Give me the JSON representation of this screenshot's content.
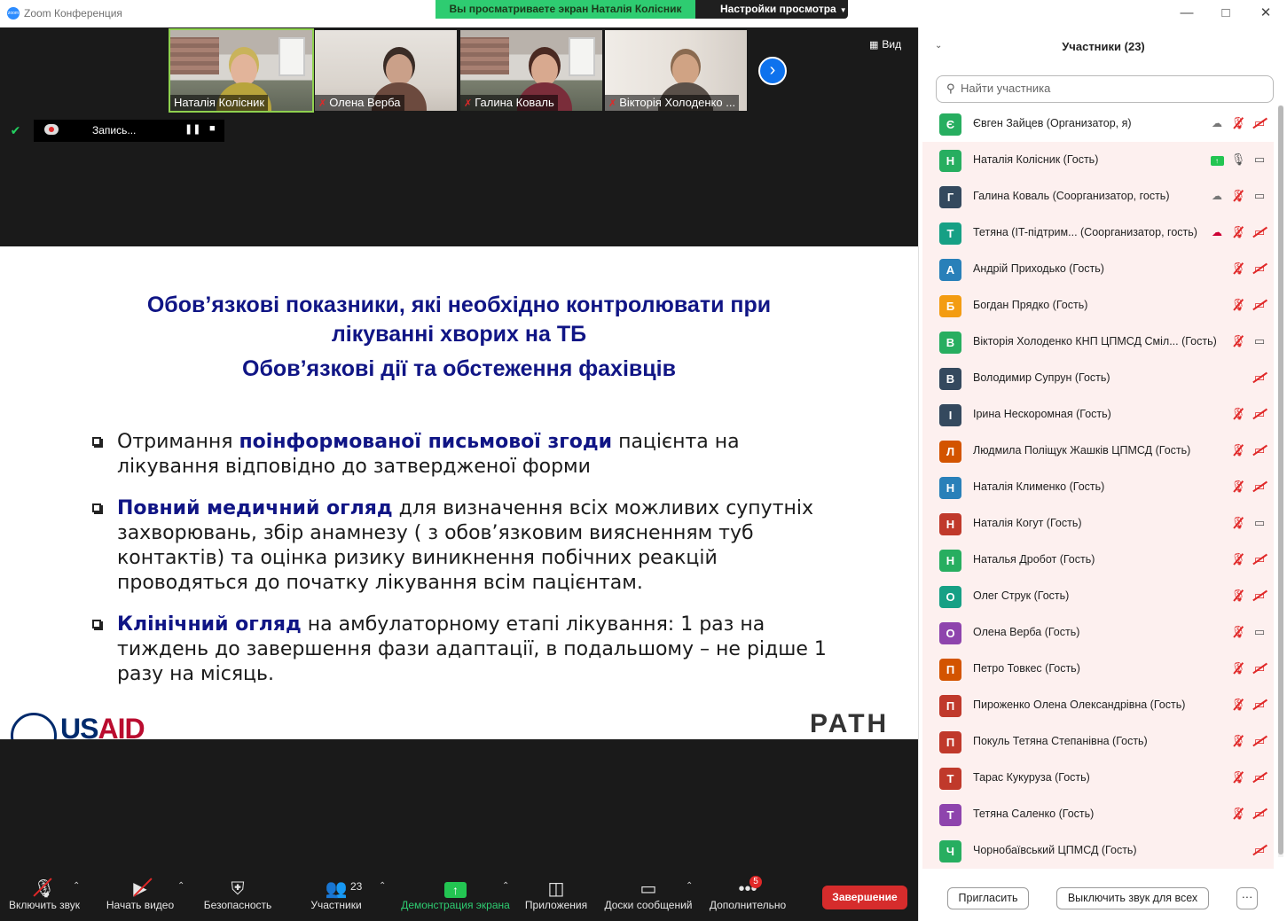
{
  "window": {
    "app_title": "Zoom Конференция",
    "app_logo_text": "zoom",
    "share_banner": "Вы просматриваете экран Наталія Колісник",
    "view_options": "Настройки просмотра"
  },
  "video": {
    "thumbnails": [
      {
        "name": "Наталія Колісник",
        "muted": false,
        "active": true
      },
      {
        "name": "Олена Верба",
        "muted": true,
        "active": false
      },
      {
        "name": "Галина Коваль",
        "muted": true,
        "active": false
      },
      {
        "name": "Вікторія Холоденко ...",
        "muted": true,
        "active": false
      }
    ],
    "view_label": "Вид",
    "recording_label": "Запись..."
  },
  "slide": {
    "title_line1": "Обов’язкові показники, які необхідно контролювати при",
    "title_line2": "лікуванні хворих на ТБ",
    "title_line3": "Обов’язкові дії та обстеження фахівців",
    "bullets": [
      {
        "pre": "Отримання ",
        "hl": "поінформованої письмової згоди",
        "post": " пацієнта на лікування відповідно до затвердженої форми"
      },
      {
        "pre": "",
        "hl": "Повний медичний огляд",
        "post": " для визначення всіх можливих супутніх захворювань, збір анамнезу ( з обов’язковим виясненням туб контактів) та оцінка ризику виникнення побічних реакцій проводяться до початку лікування всім пацієнтам."
      },
      {
        "pre": "",
        "hl": "Клінічний огляд",
        "post": " на амбулаторному етапі лікування: 1 раз на тиждень до завершення фази адаптації, в подальшому – не рідше 1 разу на місяць."
      }
    ],
    "logo_left": "USAID",
    "logo_right": "PATH"
  },
  "toolbar": {
    "audio": "Включить звук",
    "video": "Начать видео",
    "security": "Безопасность",
    "participants": "Участники",
    "participants_count": "23",
    "share": "Демонстрация экрана",
    "apps": "Приложения",
    "whiteboards": "Доски сообщений",
    "more": "Дополнительно",
    "more_badge": "5",
    "end": "Завершение"
  },
  "panel": {
    "title": "Участники (23)",
    "search_placeholder": "Найти участника",
    "participants": [
      {
        "initial": "Є",
        "name": "Євген Зайцев (Организатор, я)",
        "color": "#27ae60",
        "icons": [
          "cloud",
          "mic-off",
          "cam-off"
        ]
      },
      {
        "initial": "Н",
        "name": "Наталія Колісник (Гость)",
        "color": "#27ae60",
        "icons": [
          "share",
          "mic-on",
          "cam-on"
        ]
      },
      {
        "initial": "Г",
        "name": "Галина Коваль (Соорганизатор, гость)",
        "color": "#34495e",
        "icons": [
          "cloud",
          "mic-off",
          "cam-on"
        ]
      },
      {
        "initial": "Т",
        "name": "Тетяна (IT-підтрим...  (Соорганизатор, гость)",
        "color": "#16a085",
        "icons": [
          "cloud-red",
          "mic-off",
          "cam-off"
        ]
      },
      {
        "initial": "А",
        "name": "Андрій Приходько (Гость)",
        "color": "#2980b9",
        "icons": [
          "mic-off",
          "cam-off"
        ]
      },
      {
        "initial": "Б",
        "name": "Богдан Прядко (Гость)",
        "color": "#f39c12",
        "icons": [
          "mic-off",
          "cam-off"
        ]
      },
      {
        "initial": "В",
        "name": "Вікторія Холоденко КНП ЦПМСД Сміл...  (Гость)",
        "color": "#27ae60",
        "icons": [
          "mic-off",
          "cam-on"
        ]
      },
      {
        "initial": "В",
        "name": "Володимир Супрун (Гость)",
        "color": "#34495e",
        "icons": [
          "cam-off"
        ]
      },
      {
        "initial": "І",
        "name": "Ірина Нескоромная (Гость)",
        "color": "#34495e",
        "icons": [
          "mic-off",
          "cam-off"
        ]
      },
      {
        "initial": "Л",
        "name": "Людмила Поліщук Жашків ЦПМСД (Гость)",
        "color": "#d35400",
        "icons": [
          "mic-off",
          "cam-off"
        ]
      },
      {
        "initial": "Н",
        "name": "Наталія Клименко (Гость)",
        "color": "#2980b9",
        "icons": [
          "mic-off",
          "cam-off"
        ]
      },
      {
        "initial": "Н",
        "name": "Наталія Когут (Гость)",
        "color": "#c0392b",
        "icons": [
          "mic-off",
          "cam-on"
        ]
      },
      {
        "initial": "Н",
        "name": "Наталья Дробот (Гость)",
        "color": "#27ae60",
        "icons": [
          "mic-off",
          "cam-off"
        ]
      },
      {
        "initial": "О",
        "name": "Олег Струк (Гость)",
        "color": "#16a085",
        "icons": [
          "mic-off",
          "cam-off"
        ]
      },
      {
        "initial": "О",
        "name": "Олена Верба (Гость)",
        "color": "#8e44ad",
        "icons": [
          "mic-off",
          "cam-on"
        ]
      },
      {
        "initial": "П",
        "name": "Петро Товкес (Гость)",
        "color": "#d35400",
        "icons": [
          "mic-off",
          "cam-off"
        ]
      },
      {
        "initial": "П",
        "name": "Пироженко Олена Олександрівна (Гость)",
        "color": "#c0392b",
        "icons": [
          "mic-off",
          "cam-off"
        ]
      },
      {
        "initial": "П",
        "name": "Покуль Тетяна Степанівна (Гость)",
        "color": "#c0392b",
        "icons": [
          "mic-off",
          "cam-off"
        ]
      },
      {
        "initial": "Т",
        "name": "Тарас Кукуруза (Гость)",
        "color": "#c0392b",
        "icons": [
          "mic-off",
          "cam-off"
        ]
      },
      {
        "initial": "Т",
        "name": "Тетяна Саленко (Гость)",
        "color": "#8e44ad",
        "icons": [
          "mic-off",
          "cam-off"
        ]
      },
      {
        "initial": "Ч",
        "name": "Чорнобаївський ЦПМСД (Гость)",
        "color": "#27ae60",
        "icons": [
          "cam-off"
        ]
      }
    ],
    "invite": "Пригласить",
    "mute_all": "Выключить звук для всех",
    "more": "···"
  }
}
